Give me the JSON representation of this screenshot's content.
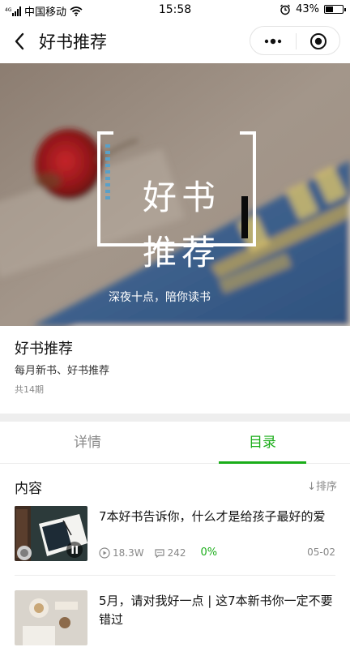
{
  "status_bar": {
    "carrier": "中国移动",
    "network": "4G",
    "time": "15:58",
    "battery_percent": "43%",
    "battery_level": 0.43
  },
  "nav": {
    "title": "好书推荐",
    "back_icon": "chevron-left-icon",
    "more_icon": "more-dots-icon",
    "close_icon": "target-close-icon"
  },
  "cover": {
    "title_line1": "好书",
    "title_line2": "推荐",
    "subtitle": "深夜十点，陪你读书"
  },
  "album": {
    "title": "好书推荐",
    "description": "每月新书、好书推荐",
    "count": "共14期"
  },
  "tabs": [
    {
      "label": "详情",
      "active": false
    },
    {
      "label": "目录",
      "active": true
    }
  ],
  "section": {
    "title": "内容",
    "sort_label": "↓排序"
  },
  "articles": [
    {
      "title": "7本好书告诉你，什么才是给孩子最好的爱",
      "plays": "18.3W",
      "comments": "242",
      "progress": "0%",
      "date": "05-02"
    },
    {
      "title": "5月，请对我好一点 | 这7本新书你一定不要错过"
    }
  ],
  "colors": {
    "accent": "#1aad19",
    "muted": "#888888",
    "divider": "#eeeeee"
  }
}
